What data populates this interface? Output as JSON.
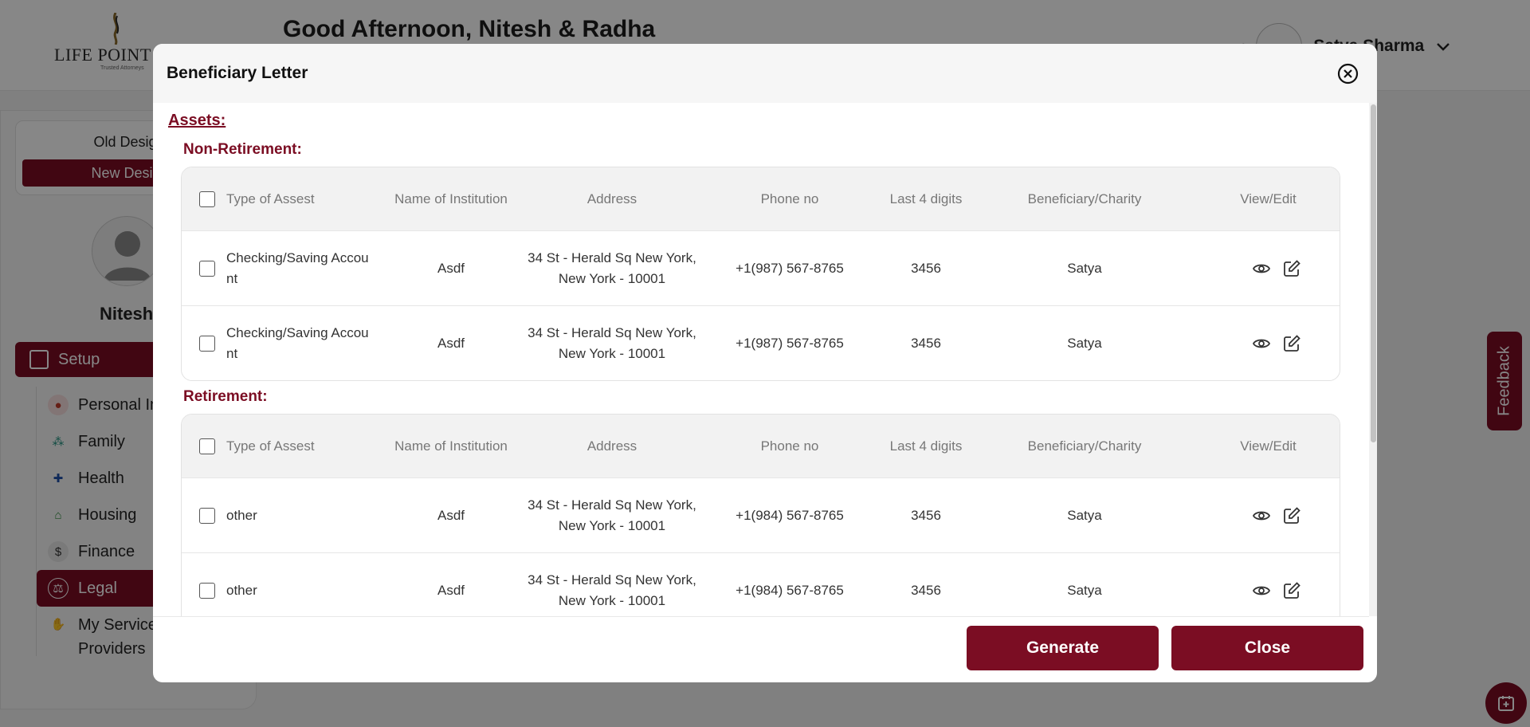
{
  "app": {
    "logo_text": "LIFE POINT",
    "logo_subtext": "Trusted Attorneys",
    "greeting": "Good Afternoon, Nitesh & Radha",
    "user_name": "Satya Sharma"
  },
  "sidebar": {
    "old_design": "Old Design",
    "new_design": "New Design",
    "profile_name": "Nitesh",
    "setup_label": "Setup",
    "items": [
      {
        "label": "Personal Info",
        "icon": "person-icon",
        "color": "#c0392b"
      },
      {
        "label": "Family",
        "icon": "family-icon",
        "color": "#1a8c7a"
      },
      {
        "label": "Health",
        "icon": "health-cross-icon",
        "color": "#1d4fa8"
      },
      {
        "label": "Housing",
        "icon": "house-icon",
        "color": "#2e8b3a"
      },
      {
        "label": "Finance",
        "icon": "dollar-icon",
        "color": "#333333"
      },
      {
        "label": "Legal",
        "icon": "scales-icon",
        "color": "#ffffff"
      },
      {
        "label": "My Service Providers",
        "icon": "handshake-icon",
        "color": "#c0392b"
      }
    ]
  },
  "feedback_label": "Feedback",
  "modal": {
    "title": "Beneficiary Letter",
    "assets_heading": "Assets:",
    "columns": [
      "Type of Assest",
      "Name of Institution",
      "Address",
      "Phone no",
      "Last 4 digits",
      "Beneficiary/Charity",
      "View/Edit"
    ],
    "sections": [
      {
        "title": "Non-Retirement:",
        "rows": [
          {
            "type": "Checking/Saving Account",
            "institution": "Asdf",
            "address": "34 St - Herald Sq New York, New York - 10001",
            "phone": "+1(987) 567-8765",
            "last4": "3456",
            "beneficiary": "Satya"
          },
          {
            "type": "Checking/Saving Account",
            "institution": "Asdf",
            "address": "34 St - Herald Sq New York, New York - 10001",
            "phone": "+1(987) 567-8765",
            "last4": "3456",
            "beneficiary": "Satya"
          }
        ]
      },
      {
        "title": "Retirement:",
        "rows": [
          {
            "type": "other",
            "institution": "Asdf",
            "address": "34 St - Herald Sq New York, New York - 10001",
            "phone": "+1(984) 567-8765",
            "last4": "3456",
            "beneficiary": "Satya"
          },
          {
            "type": "other",
            "institution": "Asdf",
            "address": "34 St - Herald Sq New York, New York - 10001",
            "phone": "+1(984) 567-8765",
            "last4": "3456",
            "beneficiary": "Satya"
          }
        ]
      }
    ],
    "generate_label": "Generate",
    "close_label": "Close"
  },
  "colors": {
    "brand": "#7b0d23",
    "overlay": "rgba(0,0,0,0.47)"
  }
}
